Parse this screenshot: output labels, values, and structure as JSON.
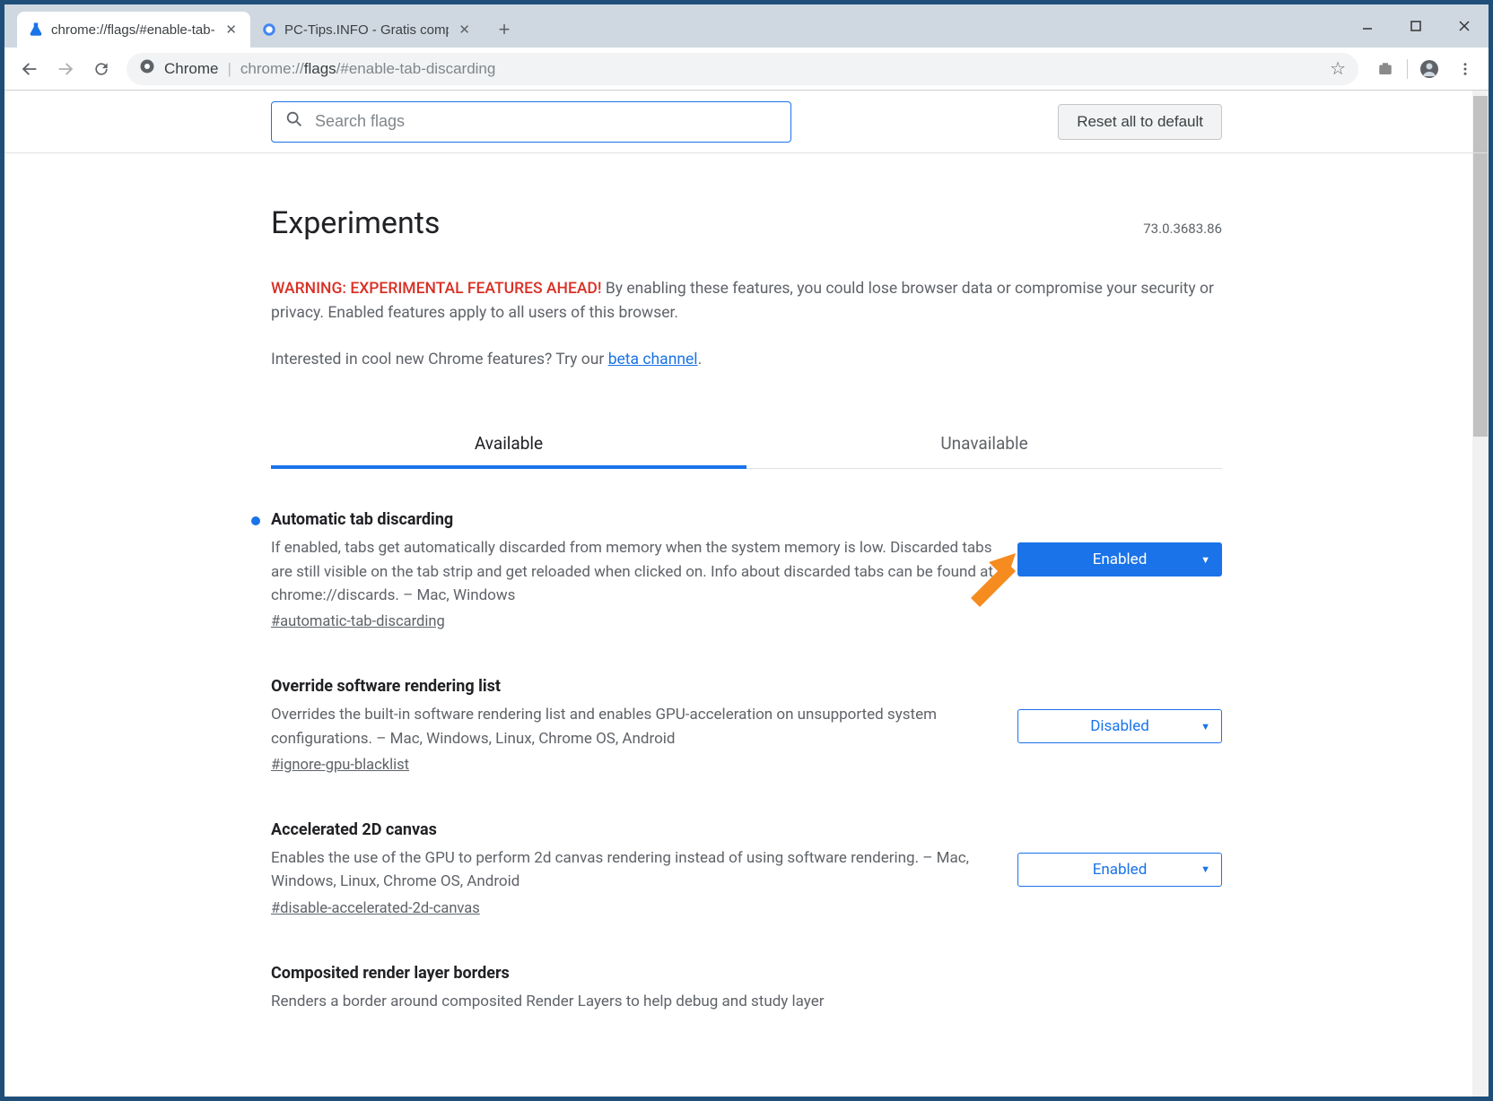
{
  "window": {
    "tabs": [
      {
        "title": "chrome://flags/#enable-tab-disc",
        "active": true,
        "favicon": "flask"
      },
      {
        "title": "PC-Tips.INFO - Gratis computer t",
        "active": false,
        "favicon": "globe"
      }
    ]
  },
  "omnibox": {
    "scheme_label": "Chrome",
    "url_prefix": "chrome://",
    "url_bold": "flags",
    "url_suffix": "/#enable-tab-discarding"
  },
  "flags_page": {
    "search_placeholder": "Search flags",
    "reset_label": "Reset all to default",
    "heading": "Experiments",
    "version": "73.0.3683.86",
    "warning_red": "WARNING: EXPERIMENTAL FEATURES AHEAD!",
    "warning_rest": " By enabling these features, you could lose browser data or compromise your security or privacy. Enabled features apply to all users of this browser.",
    "interested_prefix": "Interested in cool new Chrome features? Try our ",
    "beta_link": "beta channel",
    "interested_suffix": ".",
    "tabs": {
      "available": "Available",
      "unavailable": "Unavailable"
    },
    "flags": [
      {
        "title": "Automatic tab discarding",
        "desc": "If enabled, tabs get automatically discarded from memory when the system memory is low. Discarded tabs are still visible on the tab strip and get reloaded when clicked on. Info about discarded tabs can be found at chrome://discards. – Mac, Windows",
        "anchor": "#automatic-tab-discarding",
        "value": "Enabled",
        "filled": true,
        "modified": true
      },
      {
        "title": "Override software rendering list",
        "desc": "Overrides the built-in software rendering list and enables GPU-acceleration on unsupported system configurations. – Mac, Windows, Linux, Chrome OS, Android",
        "anchor": "#ignore-gpu-blacklist",
        "value": "Disabled",
        "filled": false,
        "modified": false
      },
      {
        "title": "Accelerated 2D canvas",
        "desc": "Enables the use of the GPU to perform 2d canvas rendering instead of using software rendering. – Mac, Windows, Linux, Chrome OS, Android",
        "anchor": "#disable-accelerated-2d-canvas",
        "value": "Enabled",
        "filled": false,
        "modified": false
      },
      {
        "title": "Composited render layer borders",
        "desc": "Renders a border around composited Render Layers to help debug and study layer",
        "anchor": "",
        "value": "",
        "filled": false,
        "modified": false
      }
    ]
  }
}
